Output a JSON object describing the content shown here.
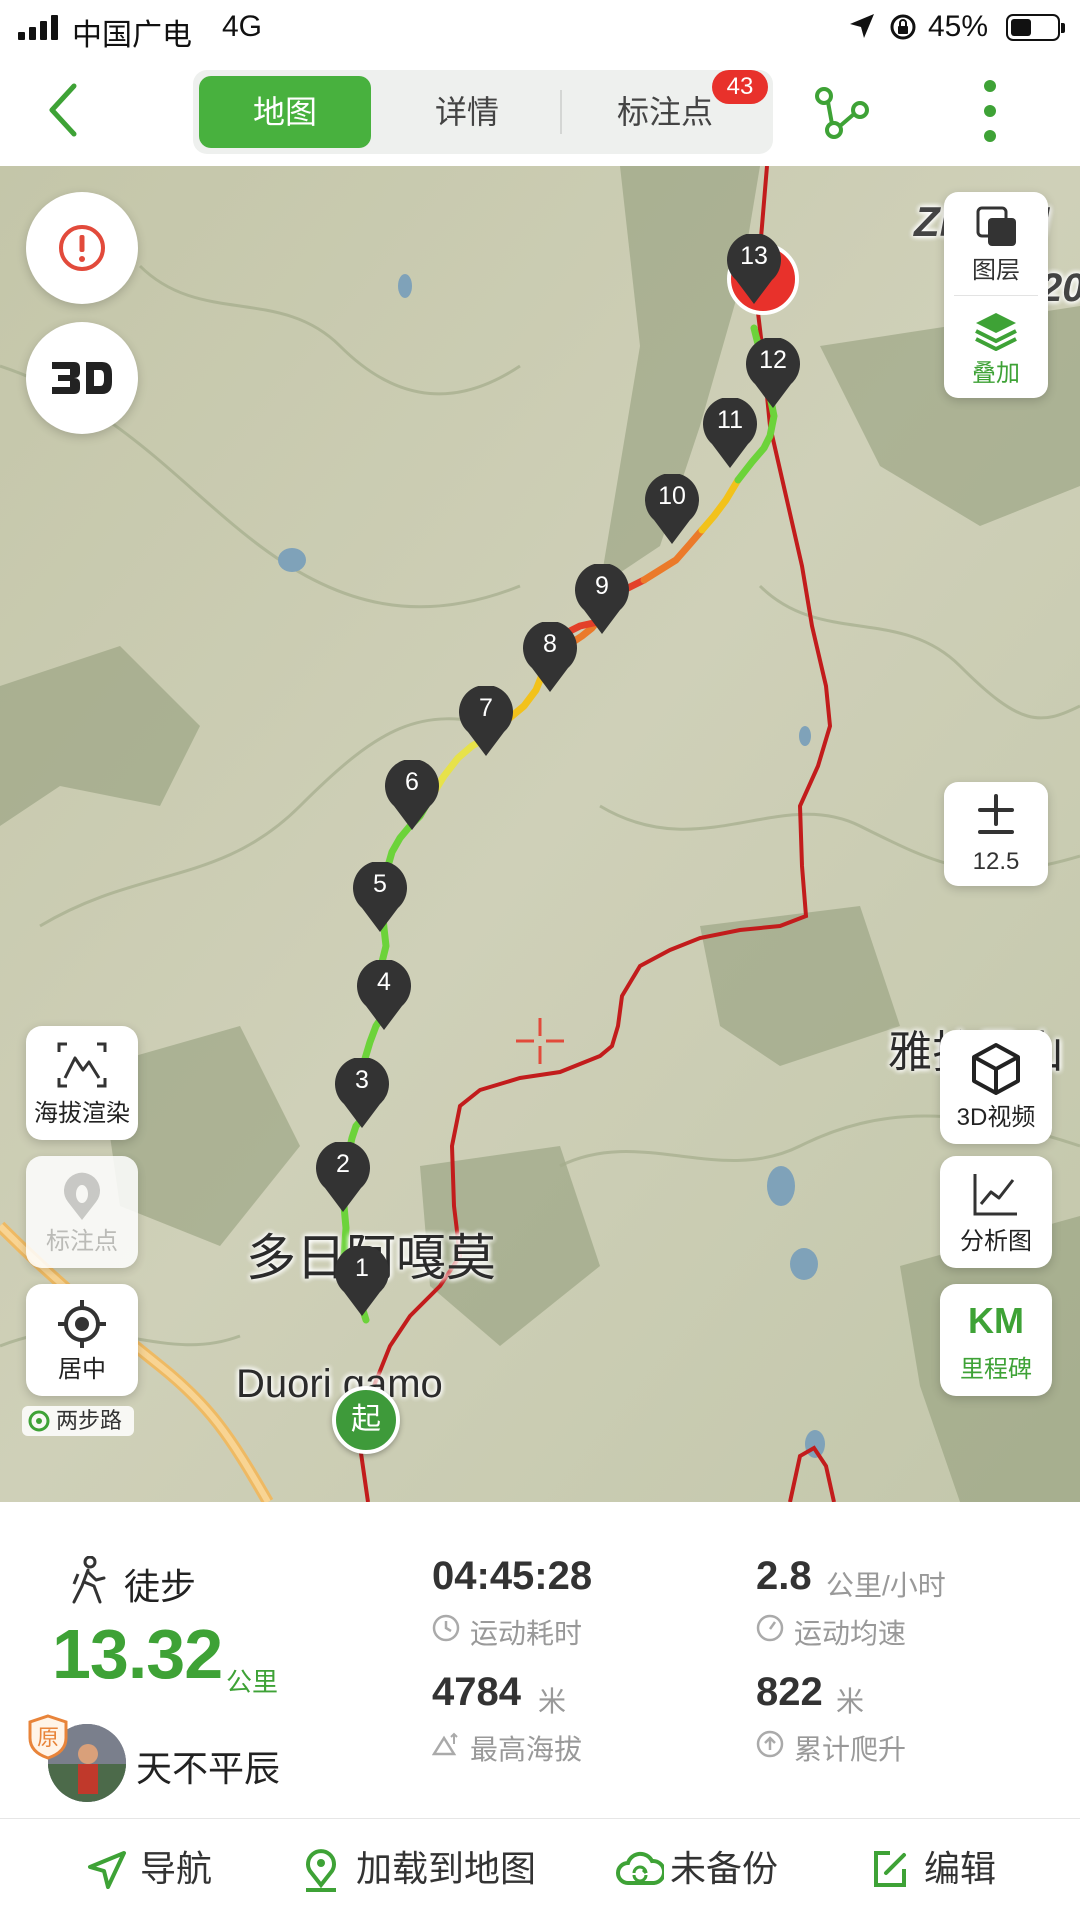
{
  "status_bar": {
    "carrier": "中国广电",
    "network": "4G",
    "battery": "45%"
  },
  "nav": {
    "tabs": [
      {
        "label": "地图",
        "active": true
      },
      {
        "label": "详情"
      },
      {
        "label": "标注点",
        "badge": "43"
      }
    ]
  },
  "map": {
    "labels": {
      "place_cn": "多日阿嘎莫",
      "place_en": "Duori gamo",
      "place_right": "雅拉雪山",
      "place_top": "ZHAILI",
      "place_top_num": "20"
    },
    "layer_panel": [
      {
        "label": "图层",
        "icon": "layers-icon"
      },
      {
        "label": "叠加",
        "icon": "overlay-icon"
      }
    ],
    "zoom_level": "12.5",
    "left_controls": [
      {
        "label": "海拔渲染",
        "icon": "elevation-icon"
      },
      {
        "label": "标注点",
        "icon": "footprint-icon",
        "disabled": true
      },
      {
        "label": "居中",
        "icon": "locate-icon"
      }
    ],
    "right_controls": [
      {
        "label": "3D视频",
        "icon": "cube-icon"
      },
      {
        "label": "分析图",
        "icon": "chart-icon"
      },
      {
        "big": "KM",
        "label": "里程碑",
        "icon": "milestone-icon"
      }
    ],
    "brand": "两步路",
    "start_label": "起",
    "markers": [
      "1",
      "2",
      "3",
      "4",
      "5",
      "6",
      "7",
      "8",
      "9",
      "10",
      "11",
      "12",
      "13"
    ],
    "route_colors": {
      "fast": "#6cd33a",
      "medium": "#f2c21b",
      "slow": "#e3402a",
      "boundary": "#c7201c"
    }
  },
  "stats": {
    "sport_type": "徒步",
    "distance": "13.32",
    "distance_unit": "公里",
    "duration": "04:45:28",
    "duration_label": "运动耗时",
    "speed": "2.8",
    "speed_unit": "公里/小时",
    "speed_label": "运动均速",
    "max_altitude": "4784",
    "max_altitude_unit": "米",
    "max_altitude_label": "最高海拔",
    "ascent": "822",
    "ascent_unit": "米",
    "ascent_label": "累计爬升",
    "user": "天不平辰",
    "original_badge": "原"
  },
  "actions": [
    {
      "label": "导航"
    },
    {
      "label": "加载到地图"
    },
    {
      "label": "未备份"
    },
    {
      "label": "编辑"
    }
  ]
}
